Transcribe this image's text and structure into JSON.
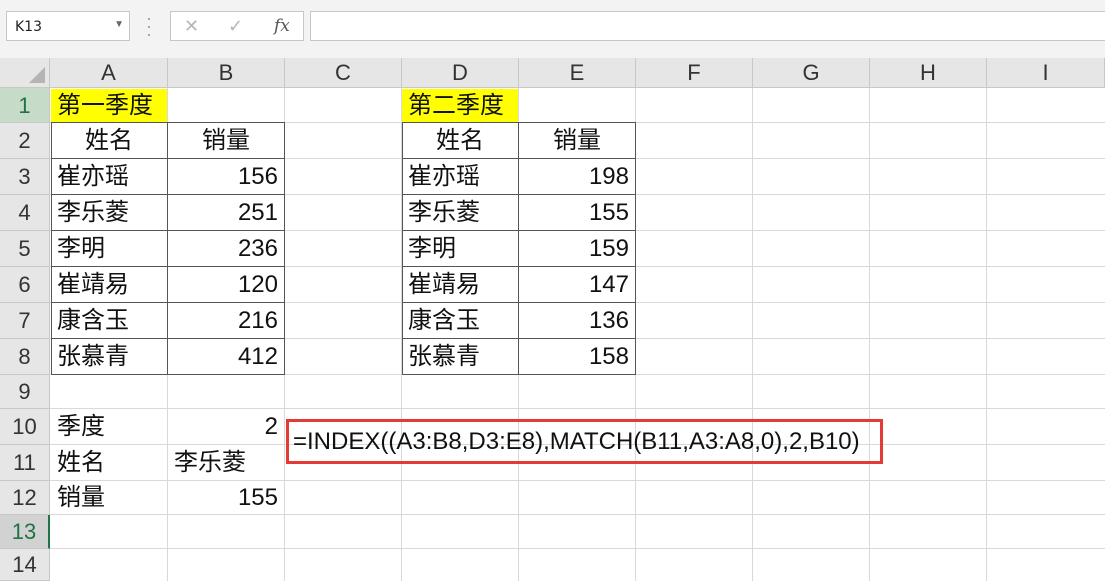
{
  "formula_bar": {
    "name_box": "K13",
    "cancel_icon": "✕",
    "enter_icon": "✓",
    "fx_label": "fx",
    "formula": ""
  },
  "columns": [
    "A",
    "B",
    "C",
    "D",
    "E",
    "F",
    "G",
    "H",
    "I"
  ],
  "rows": [
    "1",
    "2",
    "3",
    "4",
    "5",
    "6",
    "7",
    "8",
    "9",
    "10",
    "11",
    "12",
    "13",
    "14"
  ],
  "selected_row": "13",
  "table1": {
    "title": "第一季度",
    "header_name": "姓名",
    "header_sales": "销量",
    "rows": [
      {
        "name": "崔亦瑶",
        "sales": "156"
      },
      {
        "name": "李乐菱",
        "sales": "251"
      },
      {
        "name": "李明",
        "sales": "236"
      },
      {
        "name": "崔靖易",
        "sales": "120"
      },
      {
        "name": "康含玉",
        "sales": "216"
      },
      {
        "name": "张慕青",
        "sales": "412"
      }
    ]
  },
  "table2": {
    "title": "第二季度",
    "header_name": "姓名",
    "header_sales": "销量",
    "rows": [
      {
        "name": "崔亦瑶",
        "sales": "198"
      },
      {
        "name": "李乐菱",
        "sales": "155"
      },
      {
        "name": "李明",
        "sales": "159"
      },
      {
        "name": "崔靖易",
        "sales": "147"
      },
      {
        "name": "康含玉",
        "sales": "136"
      },
      {
        "name": "张慕青",
        "sales": "158"
      }
    ]
  },
  "lookup": {
    "quarter_label": "季度",
    "quarter_value": "2",
    "name_label": "姓名",
    "name_value": "李乐菱",
    "sales_label": "销量",
    "sales_value": "155",
    "formula_text": "=INDEX((A3:B8,D3:E8),MATCH(B11,A3:A8,0),2,B10)"
  },
  "colors": {
    "highlight": "#ffff00",
    "formula_border": "#e53935",
    "selection_green": "#217346"
  }
}
